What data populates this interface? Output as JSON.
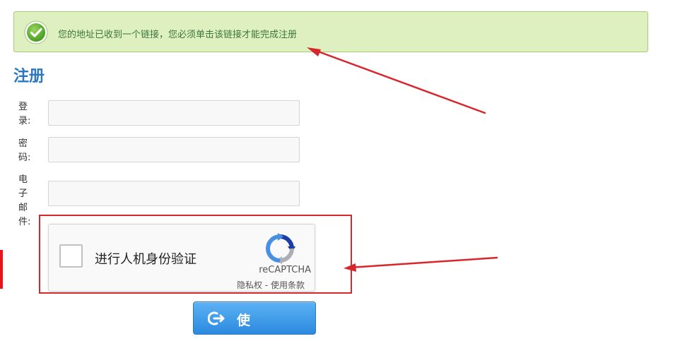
{
  "alert": {
    "message": "您的地址已收到一个链接，您必须单击该链接才能完成注册",
    "icon": "check-circle-icon",
    "color": "#3c763d",
    "background": "#dff0c0"
  },
  "form": {
    "title": "注册",
    "fields": [
      {
        "label": "登录:",
        "value": ""
      },
      {
        "label": "密码:",
        "value": ""
      },
      {
        "label": "电子邮件:",
        "value": ""
      }
    ]
  },
  "recaptcha": {
    "checkbox_label": "进行人机身份验证",
    "brand": "reCAPTCHA",
    "privacy_link": "隐私权",
    "separator": " - ",
    "terms_link": "使用条款"
  },
  "submit": {
    "label": "使",
    "icon": "login-arrow-icon",
    "color": "#2b8ae0"
  },
  "annotations": {
    "color": "#d9262c"
  }
}
